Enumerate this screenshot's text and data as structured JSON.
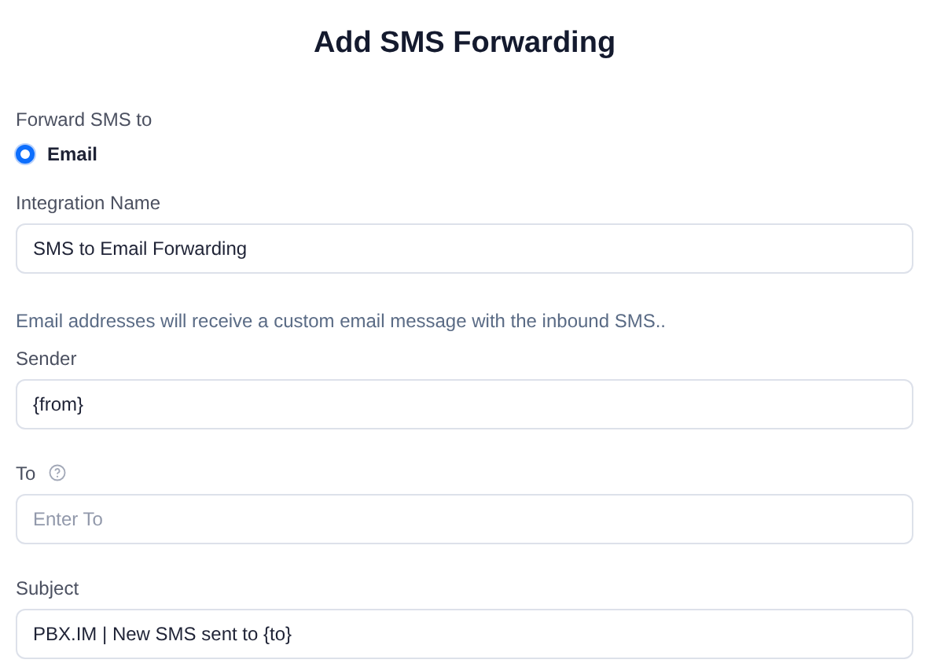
{
  "title": "Add SMS Forwarding",
  "forward_to": {
    "label": "Forward SMS to",
    "options": [
      {
        "label": "Email",
        "selected": true
      }
    ]
  },
  "integration": {
    "label": "Integration Name",
    "value": "SMS to Email Forwarding"
  },
  "note": "Email addresses will receive a custom email message with the inbound SMS..",
  "fields": [
    {
      "label": "Sender",
      "value": "{from}",
      "help_icon": false
    },
    {
      "label": "To",
      "placeholder": "Enter To",
      "help_icon": true
    },
    {
      "label": "Subject",
      "value": "PBX.IM | New SMS sent to {to}",
      "help_icon": false
    }
  ]
}
